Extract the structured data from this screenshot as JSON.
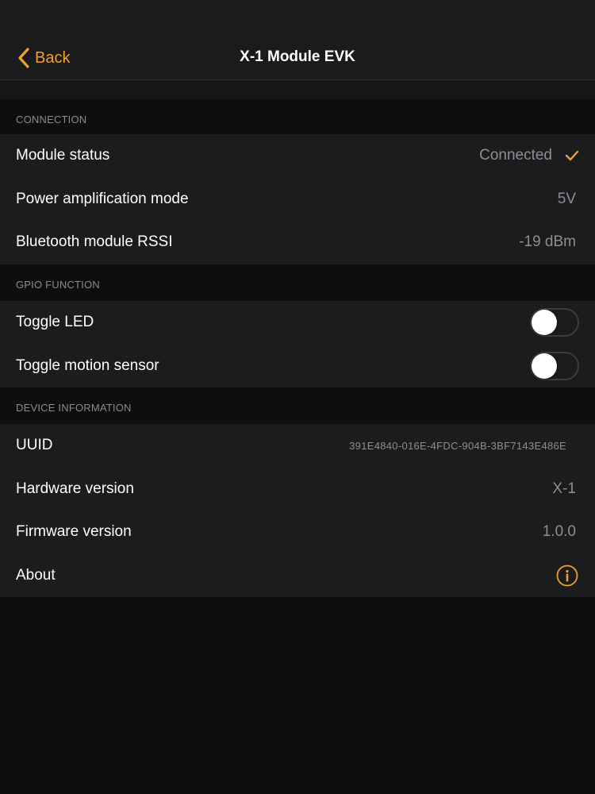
{
  "nav": {
    "back_label": "Back",
    "title": "X-1 Module EVK"
  },
  "colors": {
    "accent": "#f0a030",
    "background": "#0e0d0f",
    "cell": "#1c1b1e",
    "secondary_text": "#8e8d92"
  },
  "sections": {
    "connection": {
      "header": "CONNECTION",
      "module_status": {
        "label": "Module status",
        "value": "Connected",
        "icon": "checkmark-icon"
      },
      "power_mode": {
        "label": "Power amplification mode",
        "value": "5V"
      },
      "rssi": {
        "label": "Bluetooth module RSSI",
        "value": "-19 dBm"
      }
    },
    "gpio": {
      "header": "GPIO FUNCTION",
      "toggle_led": {
        "label": "Toggle LED",
        "on": false
      },
      "toggle_motion": {
        "label": "Toggle motion sensor",
        "on": false
      }
    },
    "device_info": {
      "header": "DEVICE INFORMATION",
      "uuid": {
        "label": "UUID",
        "value": "391E4840-016E-4FDC-904B-3BF7143E486E"
      },
      "hardware": {
        "label": "Hardware version",
        "value": "X-1"
      },
      "firmware": {
        "label": "Firmware version",
        "value": "1.0.0"
      },
      "about": {
        "label": "About",
        "icon": "info-icon"
      }
    }
  }
}
